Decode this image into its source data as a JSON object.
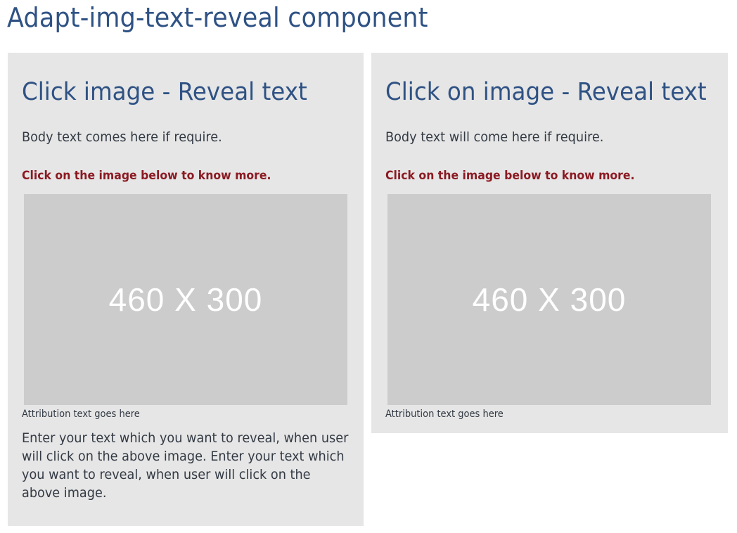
{
  "page": {
    "title": "Adapt-img-text-reveal component"
  },
  "cards": [
    {
      "heading": "Click image - Reveal text",
      "body": "Body text comes here if require.",
      "cta": "Click on the image below to know more.",
      "image_label": "460 X 300",
      "attribution": "Attribution text goes here",
      "reveal_text": "Enter your text which you want to reveal, when user will click on the above image. Enter your text which you want to reveal, when user will click on the above image."
    },
    {
      "heading": "Click on image - Reveal text",
      "body": "Body text will come here if require.",
      "cta": "Click on the image below to know more.",
      "image_label": "460 X 300",
      "attribution": "Attribution text goes here"
    }
  ],
  "colors": {
    "heading": "#2f5284",
    "cta": "#8b1a22",
    "card_background": "#e6e6e6",
    "image_placeholder": "#cccccc",
    "body_text": "#333a44"
  }
}
